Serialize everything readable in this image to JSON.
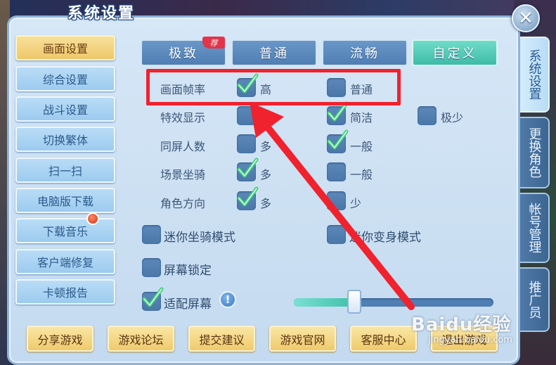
{
  "window": {
    "title": "系统设置",
    "close_glyph": "✕"
  },
  "left_menu": {
    "items": [
      {
        "label": "画面设置",
        "active": true
      },
      {
        "label": "综合设置",
        "active": false
      },
      {
        "label": "战斗设置",
        "active": false
      },
      {
        "label": "切换繁体",
        "active": false
      },
      {
        "label": "扫一扫",
        "active": false
      },
      {
        "label": "电脑版下载",
        "active": false
      },
      {
        "label": "下载音乐",
        "active": false
      },
      {
        "label": "客户端修复",
        "active": false
      },
      {
        "label": "卡顿报告",
        "active": false
      }
    ]
  },
  "right_tabs": [
    {
      "label": "系统设置",
      "active": true
    },
    {
      "label": "更换角色",
      "active": false
    },
    {
      "label": "帐号管理",
      "active": false
    },
    {
      "label": "推广员",
      "active": false
    }
  ],
  "quality_presets": {
    "items": [
      {
        "label": "极致",
        "active": false
      },
      {
        "label": "普通",
        "active": false
      },
      {
        "label": "流畅",
        "active": false
      },
      {
        "label": "自定义",
        "active": true
      }
    ],
    "badge": "荐"
  },
  "settings": {
    "frame_rate": {
      "label": "画面帧率",
      "options": [
        {
          "label": "高",
          "checked": true
        },
        {
          "label": "普通",
          "checked": false
        }
      ]
    },
    "effects": {
      "label": "特效显示",
      "options": [
        {
          "label": "多",
          "checked": false
        },
        {
          "label": "简洁",
          "checked": true
        },
        {
          "label": "极少",
          "checked": false
        }
      ]
    },
    "same_screen": {
      "label": "同屏人数",
      "options": [
        {
          "label": "多",
          "checked": false
        },
        {
          "label": "一般",
          "checked": true
        }
      ]
    },
    "mounts": {
      "label": "场景坐骑",
      "options": [
        {
          "label": "多",
          "checked": true
        },
        {
          "label": "一般",
          "checked": false
        }
      ]
    },
    "direction": {
      "label": "角色方向",
      "options": [
        {
          "label": "多",
          "checked": true
        },
        {
          "label": "少",
          "checked": false
        }
      ]
    }
  },
  "toggles": {
    "mini_mount": {
      "label": "迷你坐骑模式",
      "checked": false
    },
    "mini_transform": {
      "label": "迷你变身模式",
      "checked": false
    },
    "screen_lock": {
      "label": "屏幕锁定",
      "checked": false
    },
    "fit_screen": {
      "label": "适配屏幕",
      "checked": true
    }
  },
  "info_glyph": "!",
  "slider": {
    "value_fraction": 0.3
  },
  "bottom_buttons": [
    "分享游戏",
    "游戏论坛",
    "提交建议",
    "游戏官网",
    "客服中心",
    "退出游戏"
  ],
  "watermark": {
    "main": "Baidu经验",
    "sub": "jingyan.baidu.com"
  },
  "colors": {
    "annotation_red": "#f0222e",
    "active_tab": "#3fbba6",
    "gold_button": "#efca6c"
  }
}
